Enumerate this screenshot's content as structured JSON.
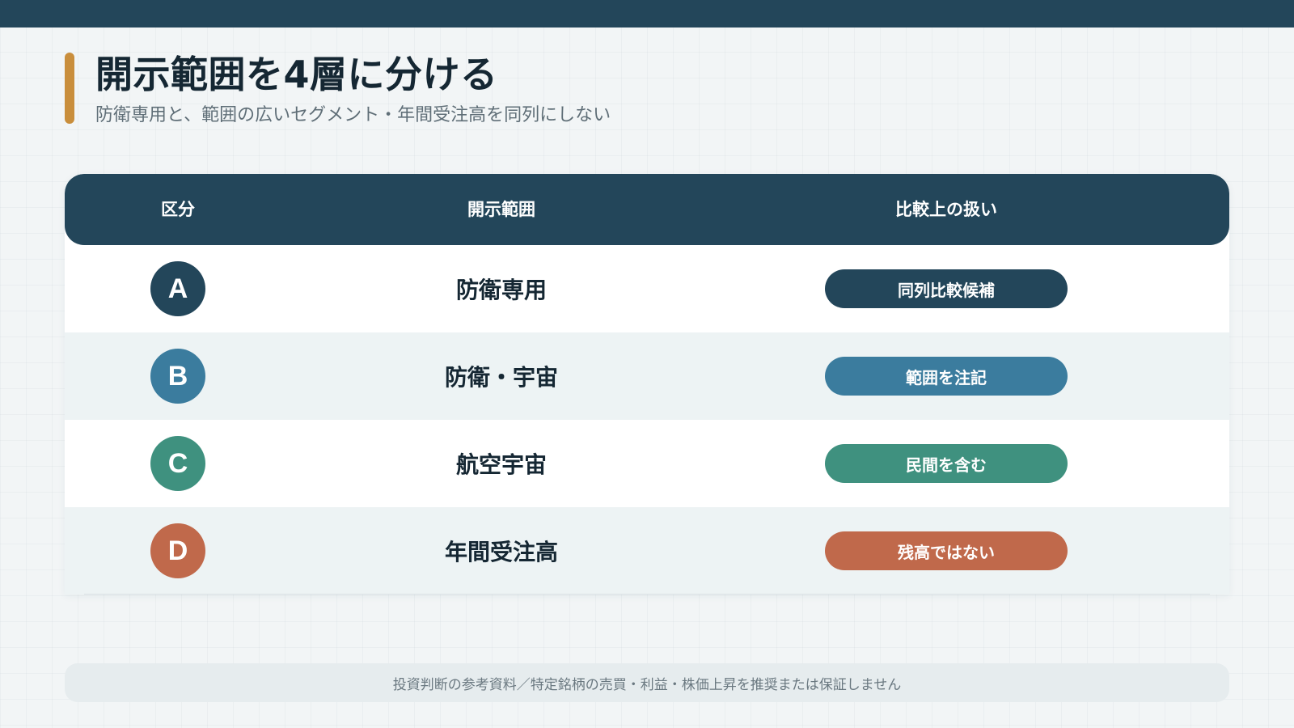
{
  "slide": {
    "title": "開示範囲を4層に分ける",
    "subtitle": "防衛専用と、範囲の広いセグメント・年間受注高を同列にしない"
  },
  "colors": {
    "navy": "#23465a",
    "accent": "#c98e3c",
    "blue": "#3b7c9e",
    "teal": "#3f917f",
    "terracotta": "#c0694b"
  },
  "table": {
    "headers": [
      "区分",
      "開示範囲",
      "比較上の扱い"
    ],
    "rows": [
      {
        "id": "A",
        "scope": "防衛専用",
        "treatment": "同列比較候補",
        "color": "#23465a"
      },
      {
        "id": "B",
        "scope": "防衛・宇宙",
        "treatment": "範囲を注記",
        "color": "#3b7c9e"
      },
      {
        "id": "C",
        "scope": "航空宇宙",
        "treatment": "民間を含む",
        "color": "#3f917f"
      },
      {
        "id": "D",
        "scope": "年間受注高",
        "treatment": "残高ではない",
        "color": "#c0694b"
      }
    ]
  },
  "footer": {
    "disclaimer": "投資判断の参考資料／特定銘柄の売買・利益・株価上昇を推奨または保証しません"
  }
}
